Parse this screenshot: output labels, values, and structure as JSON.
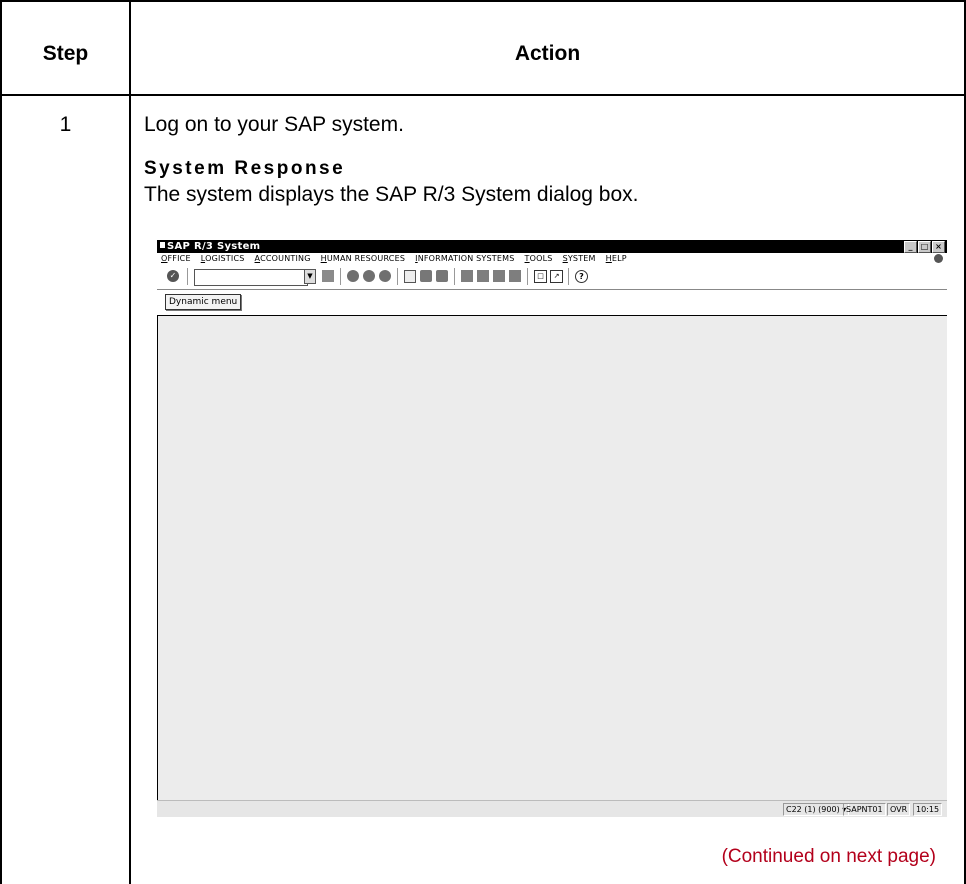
{
  "table": {
    "header_step": "Step",
    "header_action": "Action",
    "step_number": "1",
    "instruction": "Log on to your SAP system.",
    "response_heading": "System Response",
    "response_text": "The system displays the SAP R/3 System dialog box.",
    "continued": "(Continued on next page)"
  },
  "sap_window": {
    "title": "SAP R/3 System",
    "window_buttons": [
      "_",
      "□",
      "×"
    ],
    "menu": [
      "Office",
      "Logistics",
      "Accounting",
      "Human resources",
      "Information systems",
      "Tools",
      "System",
      "Help"
    ],
    "command_field_value": "",
    "dynamic_menu_label": "Dynamic menu",
    "status": {
      "system": "C22 (1) (900)",
      "server": "SAPNT01",
      "mode": "OVR",
      "time": "10:15"
    },
    "icons": [
      "check-icon",
      "save-icon",
      "back-icon",
      "exit-icon",
      "cancel-icon",
      "print-icon",
      "find-icon",
      "find-next-icon",
      "first-page-icon",
      "previous-page-icon",
      "next-page-icon",
      "last-page-icon",
      "create-session-icon",
      "shortcut-icon",
      "help-icon"
    ]
  },
  "colors": {
    "continued_text": "#b3001b",
    "sap_title_bar": "#000000",
    "sap_workspace": "#ececec"
  }
}
